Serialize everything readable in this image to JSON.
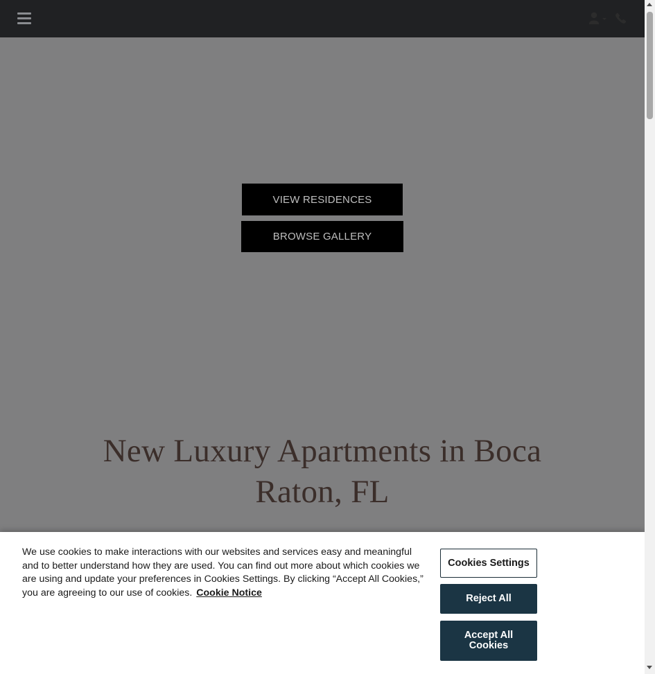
{
  "navbar": {
    "menu_icon": "hamburger-menu-icon",
    "user_icon": "user-icon",
    "phone_icon": "phone-icon"
  },
  "hero": {
    "buttons": [
      {
        "label": "VIEW RESIDENCES"
      },
      {
        "label": "BROWSE GALLERY"
      }
    ]
  },
  "headline": {
    "line1": "New Luxury Apartments in Boca",
    "line2": "Raton, FL"
  },
  "cookie_banner": {
    "text": "We use cookies to make interactions with our websites and services easy and meaningful and to better understand how they are used. You can find out more about which cookies we are using and update your preferences in Cookies Settings. By clicking “Accept All Cookies,” you are agreeing to our use of cookies.",
    "link_label": "Cookie Notice",
    "settings_label": "Cookies Settings",
    "reject_label": "Reject All",
    "accept_label": "Accept All Cookies"
  },
  "colors": {
    "navbar_bg": "#202123",
    "overlay": "#7f7f80",
    "cookie_button": "#1b3544",
    "headline": "#3b2e2a"
  }
}
